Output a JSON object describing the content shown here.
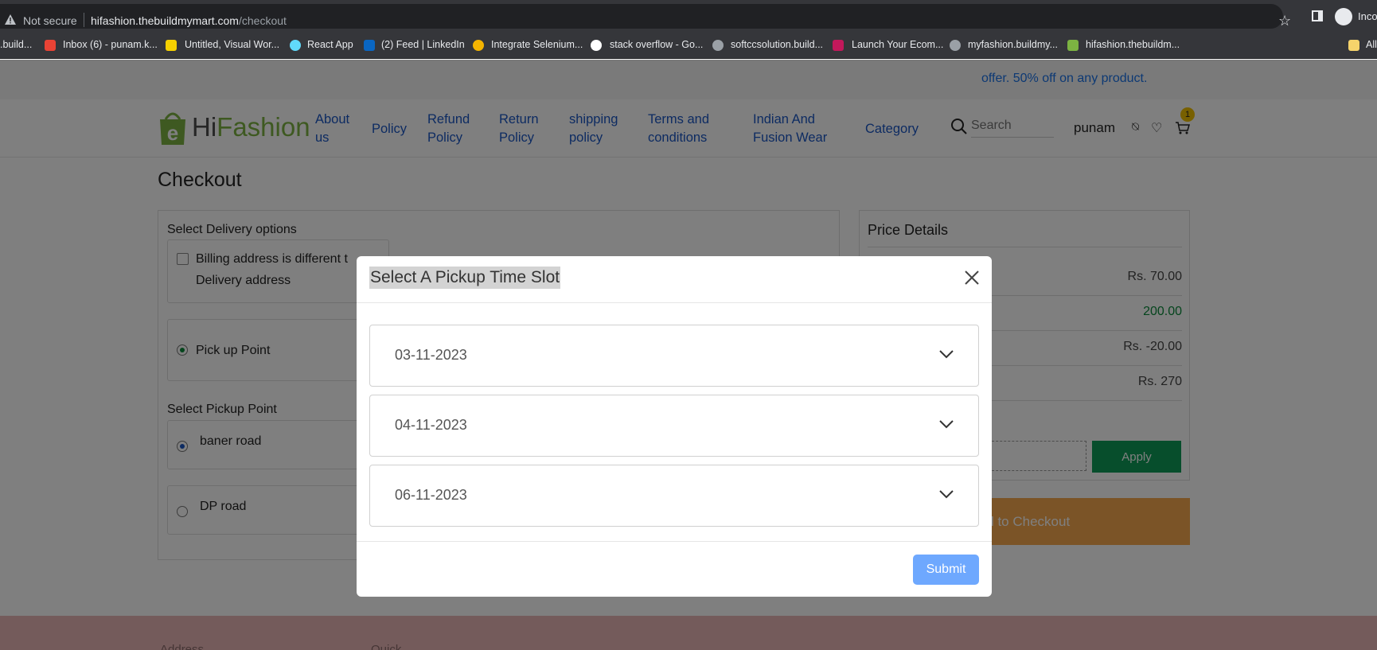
{
  "browser": {
    "security_label": "Not secure",
    "url_host": "hifashion.thebuildmymart.com",
    "url_path": "/checkout",
    "profile_label": "Incog",
    "bookmarks": [
      {
        "label": ".build..."
      },
      {
        "label": "Inbox (6) - punam.k..."
      },
      {
        "label": "Untitled, Visual Wor..."
      },
      {
        "label": "React App"
      },
      {
        "label": "(2) Feed | LinkedIn"
      },
      {
        "label": "Integrate Selenium..."
      },
      {
        "label": "stack overflow - Go..."
      },
      {
        "label": "softccsolution.build..."
      },
      {
        "label": "Launch Your Ecom..."
      },
      {
        "label": "myfashion.buildmy..."
      },
      {
        "label": "hifashion.thebuildm..."
      },
      {
        "label": "All"
      }
    ]
  },
  "offer": {
    "text": "offer. 50% off on any product."
  },
  "header": {
    "logo_part1": "Hi",
    "logo_part2": "Fashion",
    "nav": [
      {
        "line1": "About",
        "line2": "us"
      },
      {
        "line1": "Policy",
        "line2": ""
      },
      {
        "line1": "Refund",
        "line2": "Policy"
      },
      {
        "line1": "Return",
        "line2": "Policy"
      },
      {
        "line1": "shipping",
        "line2": "policy"
      },
      {
        "line1": "Terms and",
        "line2": "conditions"
      },
      {
        "line1": "Indian And",
        "line2": "Fusion Wear"
      },
      {
        "line1": "Category",
        "line2": ""
      }
    ],
    "search_placeholder": "Search",
    "username": "punam",
    "cart_count": "1"
  },
  "checkout": {
    "title": "Checkout",
    "delivery_heading": "Select Delivery options",
    "billing_line1": "Billing address is different t",
    "billing_line2": "Delivery address",
    "pickup_option": "Pick up Point",
    "pickup_heading": "Select Pickup Point",
    "pickup_points": [
      {
        "label": "baner road",
        "selected": true
      },
      {
        "label": "DP road",
        "selected": false
      }
    ]
  },
  "price_details": {
    "title": "Price Details",
    "values": [
      "Rs. 70.00",
      "200.00",
      "Rs. -20.00",
      "Rs. 270"
    ],
    "apply_label": "Apply",
    "proceed_label": "ed to Checkout"
  },
  "footer": {
    "col1": "Address",
    "col2": "Quick"
  },
  "modal": {
    "title": "Select A Pickup Time Slot",
    "dates": [
      "03-11-2023",
      "04-11-2023",
      "06-11-2023"
    ],
    "submit_label": "Submit"
  },
  "colors": {
    "link": "#1a56c4",
    "apply": "#0f9d58",
    "proceed": "#f7a84f",
    "submit": "#6ea8fe",
    "green_value": "#0a8a3a"
  }
}
